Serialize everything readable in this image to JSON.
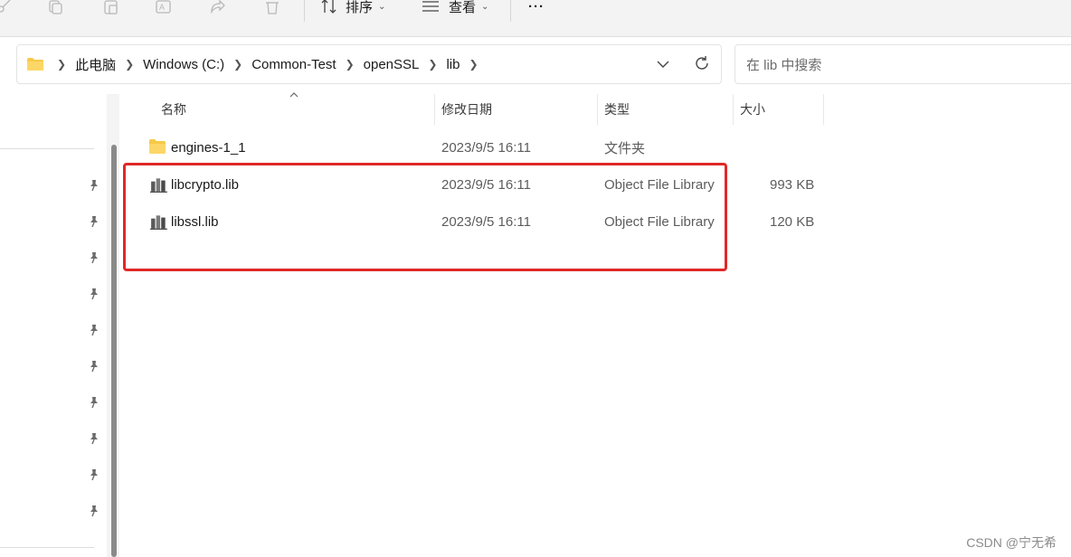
{
  "toolbar": {
    "icons": [
      "cut-icon",
      "copy-icon",
      "paste-icon",
      "rename-icon",
      "share-icon",
      "delete-icon"
    ],
    "sort_label": "排序",
    "view_label": "查看",
    "more_label": "···"
  },
  "address_bar": {
    "crumbs": [
      "此电脑",
      "Windows (C:)",
      "Common-Test",
      "openSSL",
      "lib"
    ]
  },
  "search": {
    "placeholder": "在 lib 中搜索"
  },
  "columns": {
    "name": "名称",
    "date": "修改日期",
    "type": "类型",
    "size": "大小"
  },
  "files": [
    {
      "name": "engines-1_1",
      "date": "2023/9/5 16:11",
      "type": "文件夹",
      "size": "",
      "icon": "folder-icon"
    },
    {
      "name": "libcrypto.lib",
      "date": "2023/9/5 16:11",
      "type": "Object File Library",
      "size": "993 KB",
      "icon": "library-file-icon"
    },
    {
      "name": "libssl.lib",
      "date": "2023/9/5 16:11",
      "type": "Object File Library",
      "size": "120 KB",
      "icon": "library-file-icon"
    }
  ],
  "annotation": {
    "color": "#e02828"
  },
  "watermark": "CSDN @宁无希",
  "colors": {
    "folder": "#f7c948",
    "accent": "#005fb8"
  }
}
